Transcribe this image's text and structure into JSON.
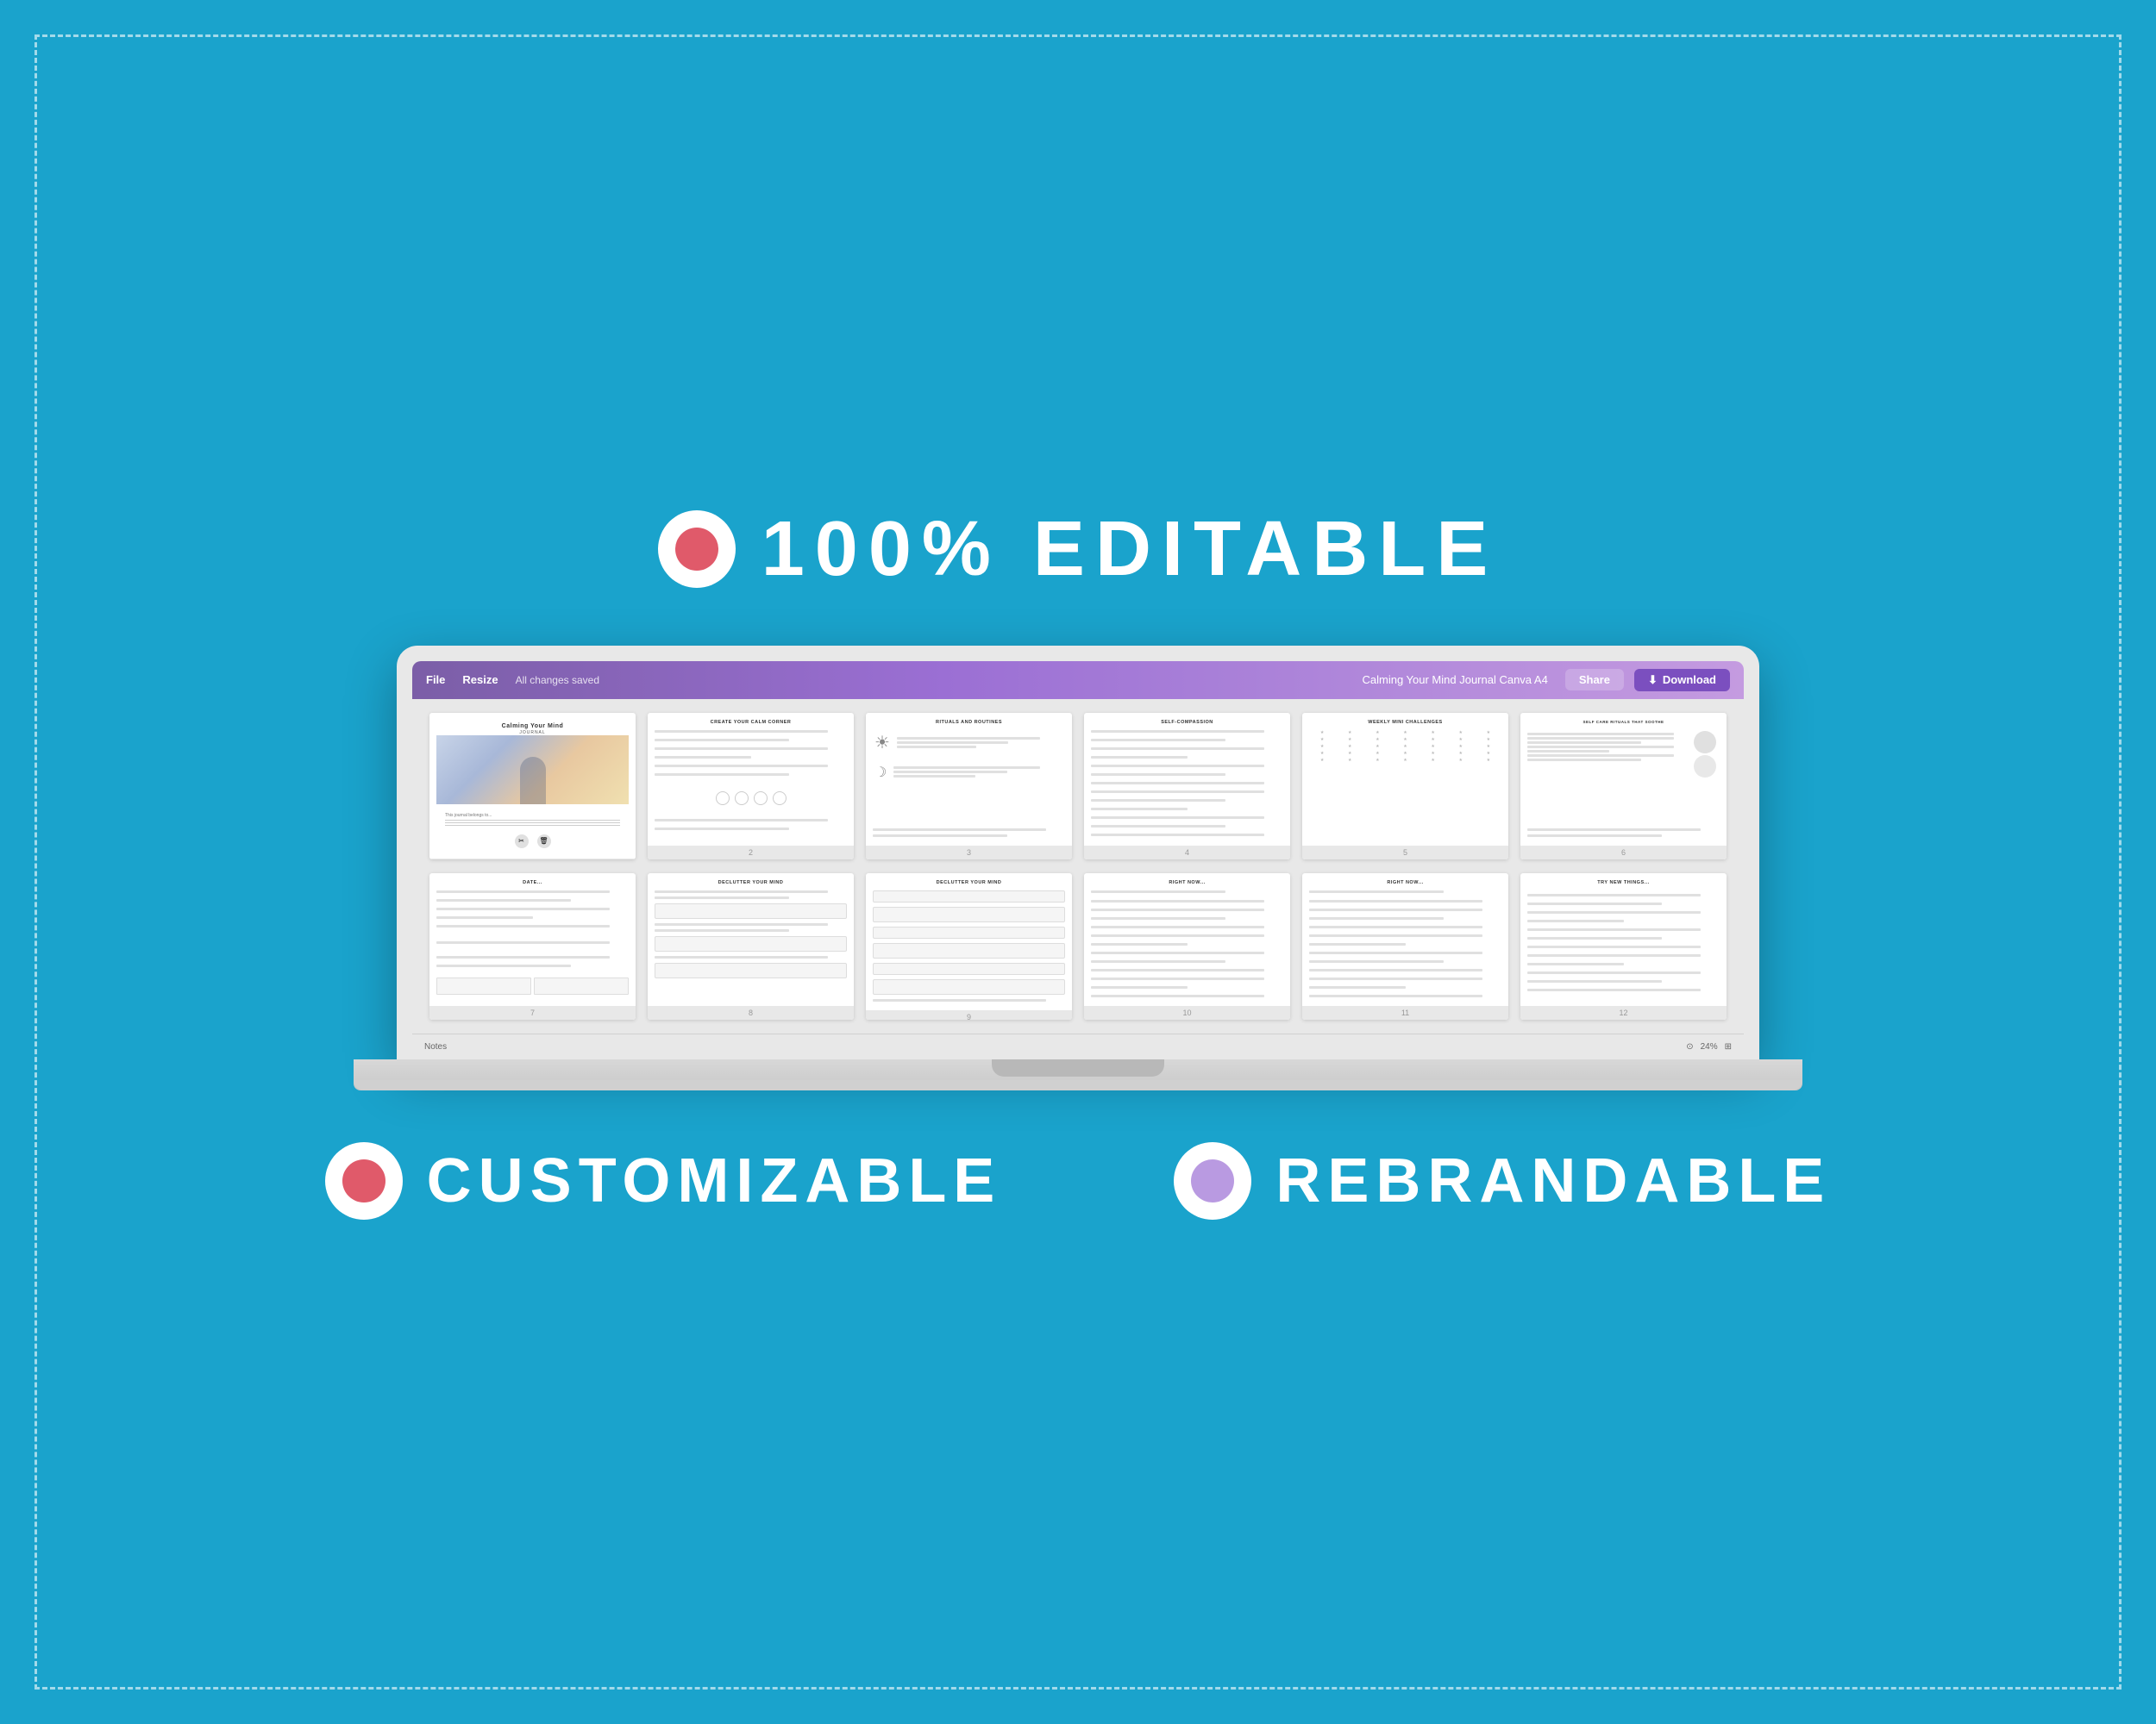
{
  "page": {
    "background_color": "#1aa3cc",
    "dashed_border_color": "rgba(255,255,255,0.6)"
  },
  "top_badge": {
    "text": "100% EDITABLE"
  },
  "laptop": {
    "toolbar": {
      "file_label": "File",
      "resize_label": "Resize",
      "saved_label": "All changes saved",
      "document_title": "Calming Your Mind Journal Canva A4",
      "share_label": "Share",
      "download_label": "Download"
    },
    "bottom_bar": {
      "notes_label": "Notes",
      "zoom_level": "24%"
    }
  },
  "pages_row1": [
    {
      "id": 1,
      "title": "Calming Your Mind",
      "subtitle": "JOURNAL",
      "has_image": true,
      "number": ""
    },
    {
      "id": 2,
      "title": "CREATE YOUR CALM CORNER",
      "number": "2"
    },
    {
      "id": 3,
      "title": "RITUALS AND ROUTINES",
      "number": "3",
      "has_sun_moon": true
    },
    {
      "id": 4,
      "title": "SELF-COMPASSION",
      "number": "4"
    },
    {
      "id": 5,
      "title": "WEEKLY MINI CHALLENGES",
      "number": "5",
      "has_stars": true
    },
    {
      "id": 6,
      "title": "SELF CARE RITUALS THAT SOOTHE",
      "number": "6"
    }
  ],
  "pages_row2": [
    {
      "id": 7,
      "title": "Date...",
      "number": "7"
    },
    {
      "id": 8,
      "title": "DECLUTTER YOUR MIND",
      "number": "8"
    },
    {
      "id": 9,
      "title": "DECLUTTER YOUR MIND",
      "number": "9"
    },
    {
      "id": 10,
      "title": "Right now...",
      "number": "10"
    },
    {
      "id": 11,
      "title": "Right now...",
      "number": "11"
    },
    {
      "id": 12,
      "title": "Try new things...",
      "number": "12"
    }
  ],
  "bottom_badges": {
    "customizable": "CUSTOMIZABLE",
    "rebrandable": "REBRANDABLE"
  }
}
